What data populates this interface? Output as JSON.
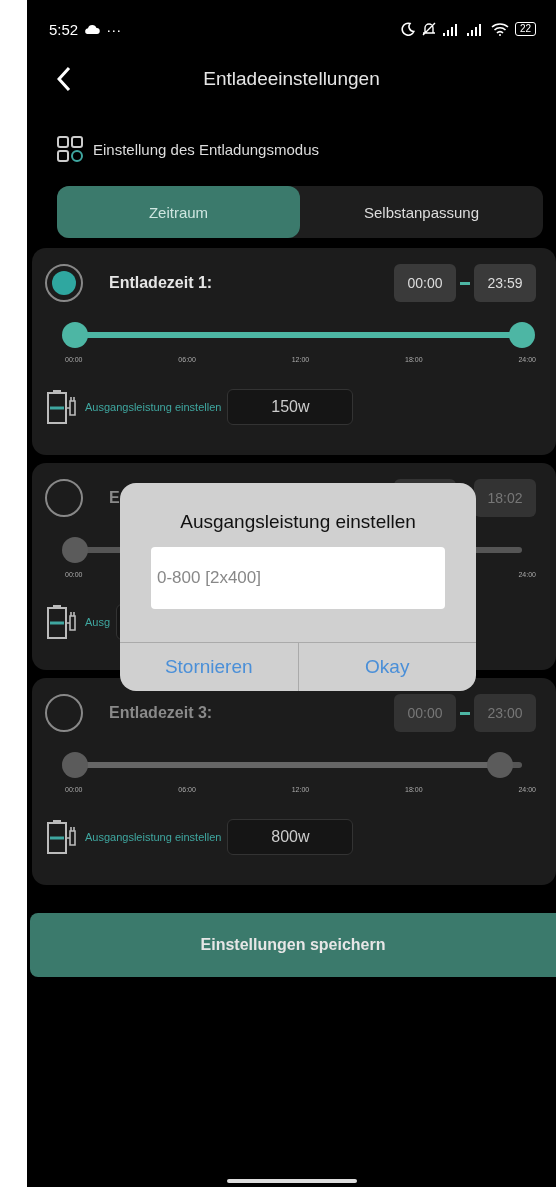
{
  "status_bar": {
    "time": "5:52",
    "more": "···",
    "battery": "22"
  },
  "header": {
    "title": "Entladeeinstellungen"
  },
  "mode": {
    "label": "Einstellung des Entladungsmodus"
  },
  "tabs": [
    {
      "label": "Zeitraum",
      "selected": true
    },
    {
      "label": "Selbstanpassung",
      "selected": false
    }
  ],
  "periods": [
    {
      "label": "Entladezeit 1:",
      "selected": true,
      "start": "00:00",
      "end": "23:59",
      "thumbs": [
        {
          "level": 0
        },
        {
          "level": 1
        }
      ],
      "ticks": [
        "00:00",
        "06:00",
        "12:00",
        "18:00",
        "24:00"
      ],
      "power_label": "Ausgangsleistung einstellen",
      "power": "150w"
    },
    {
      "label": "E",
      "selected": false,
      "end": "18:02",
      "thumbs": [
        {
          "level": 0
        }
      ],
      "ticks": [
        "00:00",
        "24:00"
      ],
      "power_label": "Ausg"
    },
    {
      "label": "Entladezeit 3:",
      "selected": false,
      "start": "00:00",
      "end": "23:00",
      "thumbs": [
        {
          "level": 0
        },
        {
          "level": 0.95
        }
      ],
      "ticks": [
        "00:00",
        "06:00",
        "12:00",
        "18:00",
        "24:00"
      ],
      "power_label": "Ausgangsleistung einstellen",
      "power": "800w"
    }
  ],
  "dialog": {
    "title": "Ausgangsleistung einstellen",
    "placeholder": "0-800 [2x400]",
    "buttons": [
      "Stornieren",
      "Okay"
    ]
  },
  "save_button": "Einstellungen speichern"
}
